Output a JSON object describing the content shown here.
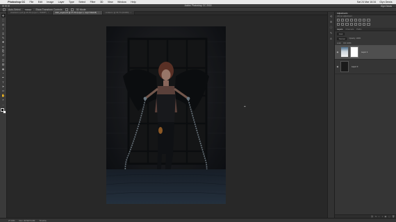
{
  "menubar": {
    "apple": "",
    "items": [
      "Photoshop CC",
      "File",
      "Edit",
      "Image",
      "Layer",
      "Type",
      "Select",
      "Filter",
      "3D",
      "View",
      "Window",
      "Help"
    ],
    "right": {
      "time": "Sat 24 Mar 16:34",
      "user": "Glyn Dewis"
    }
  },
  "titlebar": {
    "title": "Adobe Photoshop CC 2015",
    "workspace": "Glyn Dewis"
  },
  "options": {
    "tool_label": "Auto-Select",
    "target": "Group",
    "transform_label": "Show Transform Controls",
    "mode_label": "3D Mode:"
  },
  "tabs": [
    {
      "label": "shackled-1.psd @ 25.3% (Layer 1, RGB/8*)",
      "close": "×",
      "active": false
    },
    {
      "label": "dark_angel.psd @ 27.2% (Layer 1, Layer Mask/8)",
      "close": "×",
      "active": true
    },
    {
      "label": "Untitled-1 @ 66.7% (RGB/8)",
      "close": "×",
      "active": false
    }
  ],
  "tools": [
    "move",
    "marquee",
    "lasso",
    "quick-select",
    "crop",
    "eyedropper",
    "healing",
    "brush",
    "clone",
    "history-brush",
    "eraser",
    "gradient",
    "blur",
    "dodge",
    "pen",
    "type",
    "path-select",
    "shape",
    "hand",
    "zoom",
    "more"
  ],
  "tool_glyphs": [
    "✥",
    "⬚",
    "ʘ",
    "⌇",
    "⌗",
    "✎",
    "✚",
    "✏",
    "⎘",
    "↺",
    "◫",
    "▤",
    "◉",
    "◔",
    "✒",
    "T",
    "➤",
    "▭",
    "✋",
    "⌕",
    "…"
  ],
  "canvas": {
    "cursor_glyph": "⌖"
  },
  "statusbar": {
    "zoom": "27.19%",
    "doc": "Doc: 36.5M/74.0M",
    "timeline": "Timeline"
  },
  "panels": {
    "adjustments": {
      "title": "Adjustments",
      "subtitle": "Add an adjustment"
    },
    "layers": {
      "tabs": [
        "Layers",
        "Channels",
        "Paths"
      ],
      "kind": "Kind",
      "blend": "Normal",
      "opacity": "Opacity: 100%",
      "fill": "Fill: 100%",
      "lock": "Lock:",
      "rows": [
        {
          "name": "Layer 1",
          "selected": true,
          "has_mask": true,
          "thumb": "light"
        },
        {
          "name": "Layer 0",
          "selected": false,
          "has_mask": false,
          "thumb": "dark"
        }
      ]
    },
    "footer_icons": [
      "link-icon",
      "fx-icon",
      "mask-icon",
      "adjustment-icon",
      "folder-icon",
      "new-layer-icon",
      "trash-icon"
    ],
    "footer_glyphs": [
      "⛓",
      "fx",
      "◐",
      "◑",
      "▣",
      "▢",
      "🗑"
    ]
  },
  "colors": {
    "accent": "#4f4f4f",
    "bg": "#282828"
  }
}
